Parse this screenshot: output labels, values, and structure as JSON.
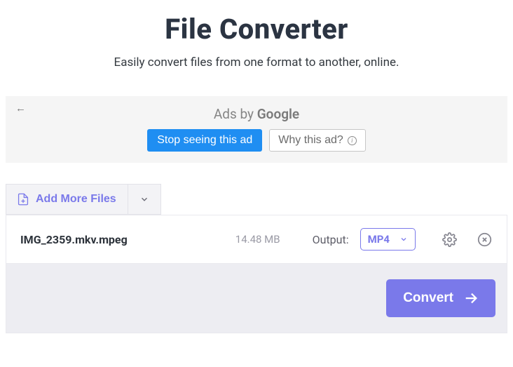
{
  "header": {
    "title": "File Converter",
    "subtitle": "Easily convert files from one format to another, online."
  },
  "ad": {
    "by_prefix": "Ads by ",
    "by_brand": "Google",
    "stop_label": "Stop seeing this ad",
    "why_label": "Why this ad?"
  },
  "toolbar": {
    "add_more_label": "Add More Files"
  },
  "file": {
    "name": "IMG_2359.mkv.mpeg",
    "size": "14.48 MB",
    "output_label": "Output:",
    "format": "MP4"
  },
  "actions": {
    "convert_label": "Convert"
  }
}
